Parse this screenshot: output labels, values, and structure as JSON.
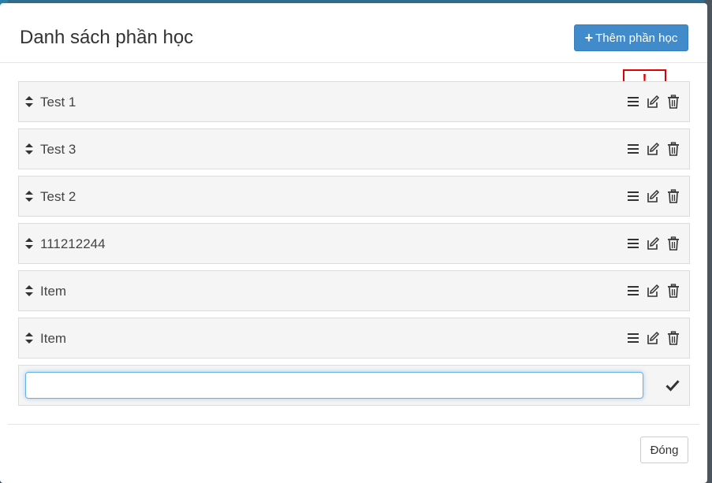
{
  "modal": {
    "title": "Danh sách phần học",
    "add_button_label": "Thêm phần học",
    "alert_mark": "!",
    "close_button_label": "Đóng"
  },
  "items": [
    {
      "label": "Test 1"
    },
    {
      "label": "Test 3"
    },
    {
      "label": "Test 2"
    },
    {
      "label": "111212244"
    },
    {
      "label": "Item"
    },
    {
      "label": "Item"
    }
  ],
  "new_item": {
    "value": "",
    "placeholder": ""
  },
  "icons": {
    "sort": "sort-icon",
    "menu": "bars-icon",
    "edit": "edit-icon",
    "delete": "trash-icon",
    "confirm": "check-icon",
    "add": "plus-icon"
  },
  "colors": {
    "primary": "#428bca",
    "alert": "#e00000",
    "row_bg": "#f5f5f5"
  }
}
